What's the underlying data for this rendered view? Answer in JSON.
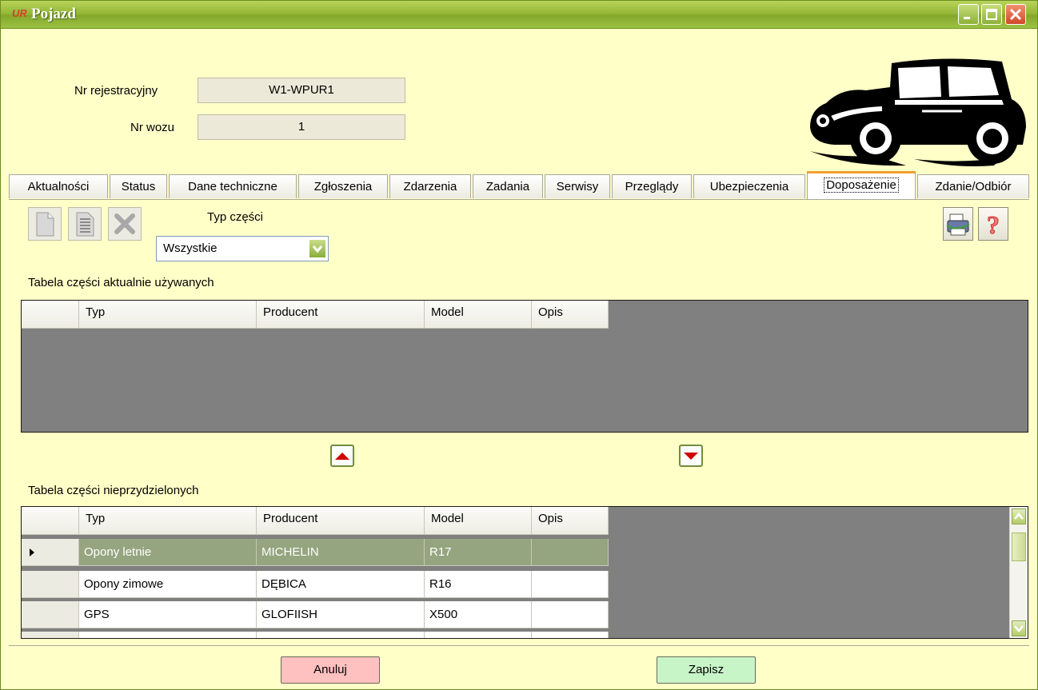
{
  "window": {
    "title": "Pojazd",
    "app_icon": "UR",
    "controls": {
      "minimize": "minimize-icon",
      "maximize": "maximize-icon",
      "close": "close-icon"
    }
  },
  "vehicle": {
    "registration_label": "Nr rejestracyjny",
    "registration_value": "W1-WPUR1",
    "car_number_label": "Nr wozu",
    "car_number_value": "1"
  },
  "tabs": [
    {
      "label": "Aktualności"
    },
    {
      "label": "Status"
    },
    {
      "label": "Dane techniczne"
    },
    {
      "label": "Zgłoszenia"
    },
    {
      "label": "Zdarzenia"
    },
    {
      "label": "Zadania"
    },
    {
      "label": "Serwisy"
    },
    {
      "label": "Przeglądy"
    },
    {
      "label": "Ubezpieczenia"
    },
    {
      "label": "Doposażenie"
    },
    {
      "label": "Zdanie/Odbiór"
    }
  ],
  "active_tab": "Doposażenie",
  "toolbar": {
    "new_icon": "new-document-icon",
    "edit_icon": "edit-document-icon",
    "delete_icon": "delete-icon",
    "print_icon": "printer-icon",
    "help_icon": "help-icon",
    "part_type_label": "Typ części",
    "part_type_value": "Wszystkie"
  },
  "used_parts": {
    "title": "Tabela części aktualnie używanych",
    "columns": [
      "Typ",
      "Producent",
      "Model",
      "Opis"
    ],
    "rows": []
  },
  "move_buttons": {
    "up": "arrow-up-icon",
    "down": "arrow-down-icon"
  },
  "unassigned_parts": {
    "title": "Tabela części nieprzydzielonych",
    "columns": [
      "Typ",
      "Producent",
      "Model",
      "Opis"
    ],
    "rows": [
      {
        "typ": "Opony letnie",
        "producent": "MICHELIN",
        "model": "R17",
        "opis": ""
      },
      {
        "typ": "Opony zimowe",
        "producent": "DĘBICA",
        "model": "R16",
        "opis": ""
      },
      {
        "typ": "GPS",
        "producent": "GLOFIISH",
        "model": "X500",
        "opis": ""
      }
    ]
  },
  "buttons": {
    "cancel": "Anuluj",
    "save": "Zapisz"
  },
  "colors": {
    "background": "#ffffc8",
    "titlebar": "#97b838",
    "selected_row": "#95a57f",
    "cancel_btn": "#ffc0c0",
    "save_btn": "#c8f5c8"
  }
}
